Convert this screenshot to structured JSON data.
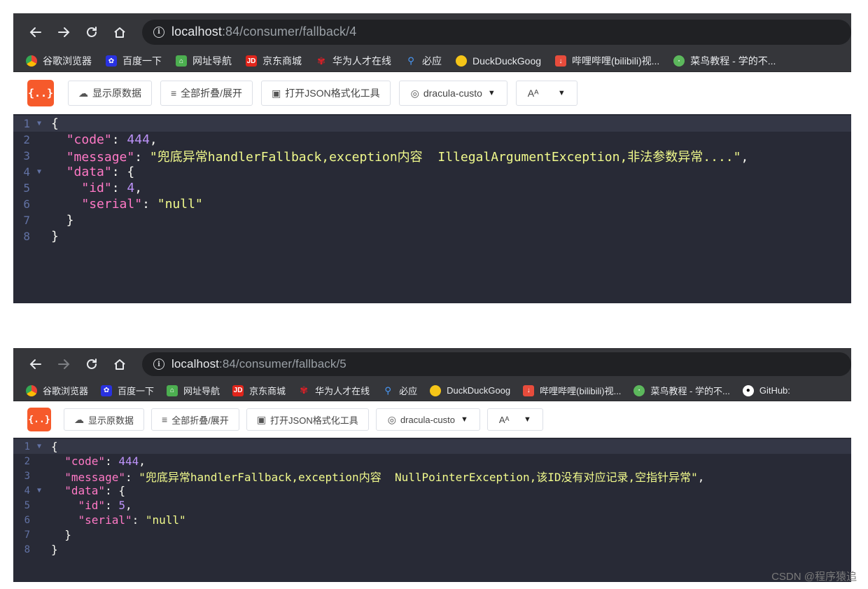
{
  "screens": [
    {
      "url_host": "localhost",
      "url_path": ":84/consumer/fallback/4",
      "bookmarks": [
        "谷歌浏览器",
        "百度一下",
        "网址导航",
        "京东商城",
        "华为人才在线",
        "必应",
        "DuckDuckGoog",
        "哔哩哔哩(bilibili)视...",
        "菜鸟教程 - 学的不..."
      ],
      "toolbar": {
        "logo": "{..}",
        "raw_label": "显示原数据",
        "fold_label": "全部折叠/展开",
        "open_tool_label": "打开JSON格式化工具",
        "theme_label": "dracula-custo",
        "font_label": "Aᴬ"
      },
      "json": {
        "code_key": "\"code\"",
        "code_value": "444",
        "message_key": "\"message\"",
        "message_value": "\"兜底异常handlerFallback,exception内容  IllegalArgumentException,非法参数异常....\"",
        "data_key": "\"data\"",
        "id_key": "\"id\"",
        "id_value": "4",
        "serial_key": "\"serial\"",
        "serial_value": "\"null\""
      }
    },
    {
      "url_host": "localhost",
      "url_path": ":84/consumer/fallback/5",
      "bookmarks": [
        "谷歌浏览器",
        "百度一下",
        "网址导航",
        "京东商城",
        "华为人才在线",
        "必应",
        "DuckDuckGoog",
        "哔哩哔哩(bilibili)视...",
        "菜鸟教程 - 学的不...",
        "GitHub:"
      ],
      "toolbar": {
        "logo": "{..}",
        "raw_label": "显示原数据",
        "fold_label": "全部折叠/展开",
        "open_tool_label": "打开JSON格式化工具",
        "theme_label": "dracula-custo",
        "font_label": "Aᴬ"
      },
      "json": {
        "code_key": "\"code\"",
        "code_value": "444",
        "message_key": "\"message\"",
        "message_value": "\"兜底异常handlerFallback,exception内容  NullPointerException,该ID没有对应记录,空指针异常\"",
        "data_key": "\"data\"",
        "id_key": "\"id\"",
        "id_value": "5",
        "serial_key": "\"serial\"",
        "serial_value": "\"null\""
      }
    }
  ],
  "watermark": "CSDN @程序猿追",
  "colors": {
    "editor_bg": "#282a36",
    "key": "#ff79c6",
    "number": "#bd93f9",
    "string": "#f1fa8c",
    "logo": "#f65a2b",
    "chrome_bar": "#35363a"
  },
  "bookmark_icons": [
    "chrome-icon",
    "baidu-icon",
    "nav-icon",
    "jd-icon",
    "huawei-icon",
    "bing-icon",
    "duckduckgo-icon",
    "bilibili-icon",
    "runoob-icon",
    "github-icon"
  ]
}
